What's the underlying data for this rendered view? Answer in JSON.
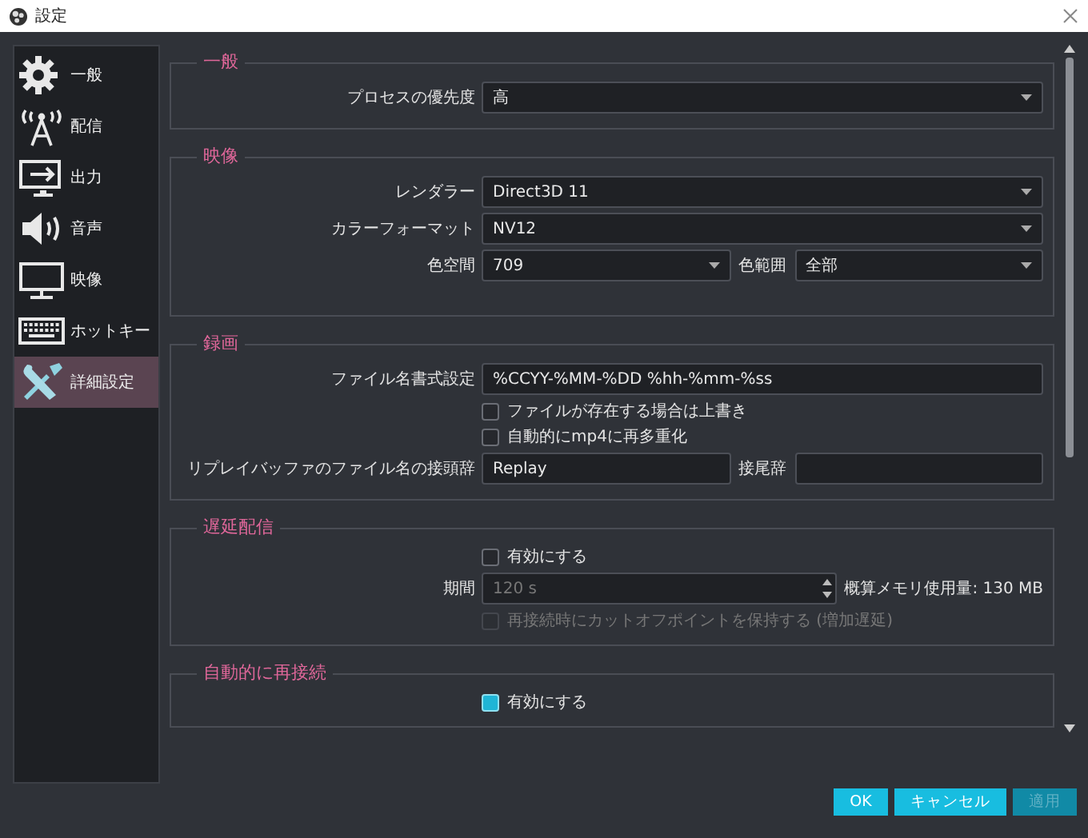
{
  "window": {
    "title": "設定"
  },
  "sidebar": {
    "items": [
      {
        "label": "一般",
        "selected": false
      },
      {
        "label": "配信",
        "selected": false
      },
      {
        "label": "出力",
        "selected": false
      },
      {
        "label": "音声",
        "selected": false
      },
      {
        "label": "映像",
        "selected": false
      },
      {
        "label": "ホットキー",
        "selected": false
      },
      {
        "label": "詳細設定",
        "selected": true
      }
    ]
  },
  "sections": [
    {
      "title": "一般",
      "rows": [
        {
          "kind": "select",
          "label": "プロセスの優先度",
          "value": "高"
        }
      ]
    },
    {
      "title": "映像",
      "rows": [
        {
          "kind": "select",
          "label": "レンダラー",
          "value": "Direct3D 11"
        },
        {
          "kind": "select",
          "label": "カラーフォーマット",
          "value": "NV12"
        },
        {
          "kind": "select_pair",
          "label": "色空間",
          "value": "709",
          "label2": "色範囲",
          "value2": "全部"
        }
      ]
    },
    {
      "title": "録画",
      "rows": [
        {
          "kind": "text",
          "label": "ファイル名書式設定",
          "value": "%CCYY-%MM-%DD %hh-%mm-%ss"
        },
        {
          "kind": "checkbox",
          "label": "ファイルが存在する場合は上書き",
          "checked": false,
          "disabled": false
        },
        {
          "kind": "checkbox",
          "label": "自動的にmp4に再多重化",
          "checked": false,
          "disabled": false
        },
        {
          "kind": "text_pair",
          "label": "リプレイバッファのファイル名の接頭辞",
          "value": "Replay",
          "label2": "接尾辞"
        }
      ]
    },
    {
      "title": "遅延配信",
      "rows": [
        {
          "kind": "checkbox",
          "label": "有効にする",
          "checked": false,
          "disabled": false
        },
        {
          "kind": "spin",
          "label": "期間",
          "value": "120 s",
          "disabled": true,
          "note": "概算メモリ使用量: 130 MB"
        },
        {
          "kind": "checkbox",
          "label": "再接続時にカットオフポイントを保持する (増加遅延)",
          "checked": false,
          "disabled": true
        }
      ]
    },
    {
      "title": "自動的に再接続",
      "rows": [
        {
          "kind": "checkbox",
          "label": "有効にする",
          "checked": true,
          "disabled": false
        }
      ]
    }
  ],
  "buttons": [
    {
      "label": "OK",
      "disabled": false
    },
    {
      "label": "キャンセル",
      "disabled": false
    },
    {
      "label": "適用",
      "disabled": true
    }
  ]
}
